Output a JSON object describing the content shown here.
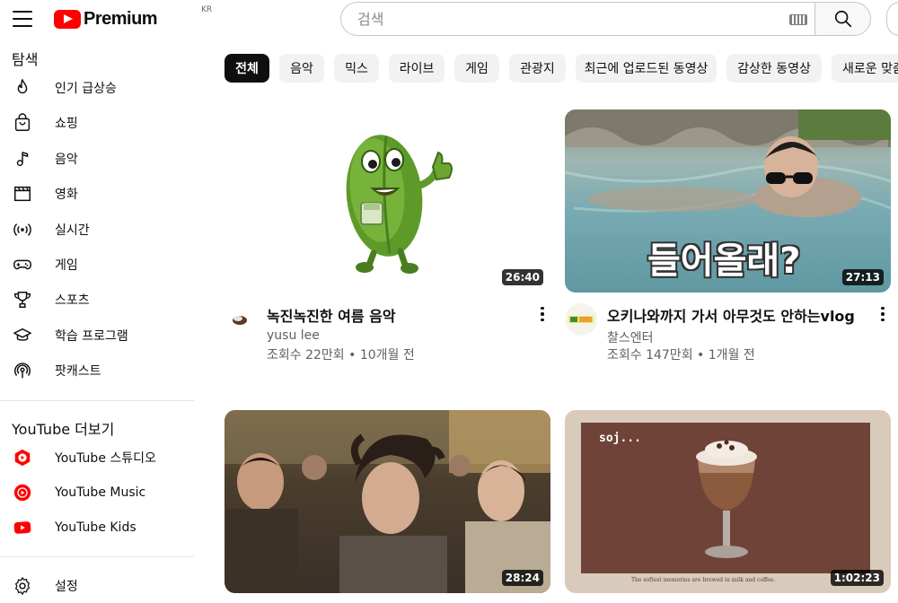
{
  "header": {
    "logo_text": "Premium",
    "country_code": "KR",
    "search_placeholder": "검색"
  },
  "sidebar": {
    "explore_heading": "탐색",
    "explore_items": [
      {
        "label": "인기 급상승",
        "icon": "trending-flame-icon"
      },
      {
        "label": "쇼핑",
        "icon": "shopping-bag-icon"
      },
      {
        "label": "음악",
        "icon": "music-note-icon"
      },
      {
        "label": "영화",
        "icon": "clapperboard-icon"
      },
      {
        "label": "실시간",
        "icon": "live-broadcast-icon"
      },
      {
        "label": "게임",
        "icon": "gamepad-icon"
      },
      {
        "label": "스포츠",
        "icon": "trophy-icon"
      },
      {
        "label": "학습 프로그램",
        "icon": "graduation-cap-icon"
      },
      {
        "label": "팟캐스트",
        "icon": "podcast-icon"
      }
    ],
    "more_heading": "YouTube 더보기",
    "more_items": [
      {
        "label": "YouTube 스튜디오",
        "icon": "youtube-studio-icon"
      },
      {
        "label": "YouTube Music",
        "icon": "youtube-music-icon"
      },
      {
        "label": "YouTube Kids",
        "icon": "youtube-kids-icon"
      }
    ],
    "settings_label": "설정"
  },
  "chips": [
    "전체",
    "음악",
    "믹스",
    "라이브",
    "게임",
    "관광지",
    "최근에 업로드된 동영상",
    "감상한 동영상",
    "새로운 맞춤"
  ],
  "videos": [
    {
      "title": "녹진녹진한 여름 음악",
      "channel": "yusu lee",
      "meta": "조회수 22만회 • 10개월 전",
      "duration": "26:40"
    },
    {
      "title": "오키나와까지 가서 아무것도 안하는vlog",
      "channel": "찰스엔터",
      "meta": "조회수 147만회 • 1개월 전",
      "duration": "27:13",
      "overlay_text": "들어올래?"
    },
    {
      "title": "",
      "channel": "",
      "meta": "",
      "duration": "28:24"
    },
    {
      "title": "",
      "channel": "",
      "meta": "",
      "duration": "1:02:23",
      "overlay_text": "soj...",
      "caption": "The softest memories are brewed in milk and coffee."
    }
  ],
  "colors": {
    "brand_red": "#ff0000",
    "chip_active_bg": "#0f0f0f",
    "chip_bg": "#f2f2f2",
    "meta_text": "#606060"
  }
}
